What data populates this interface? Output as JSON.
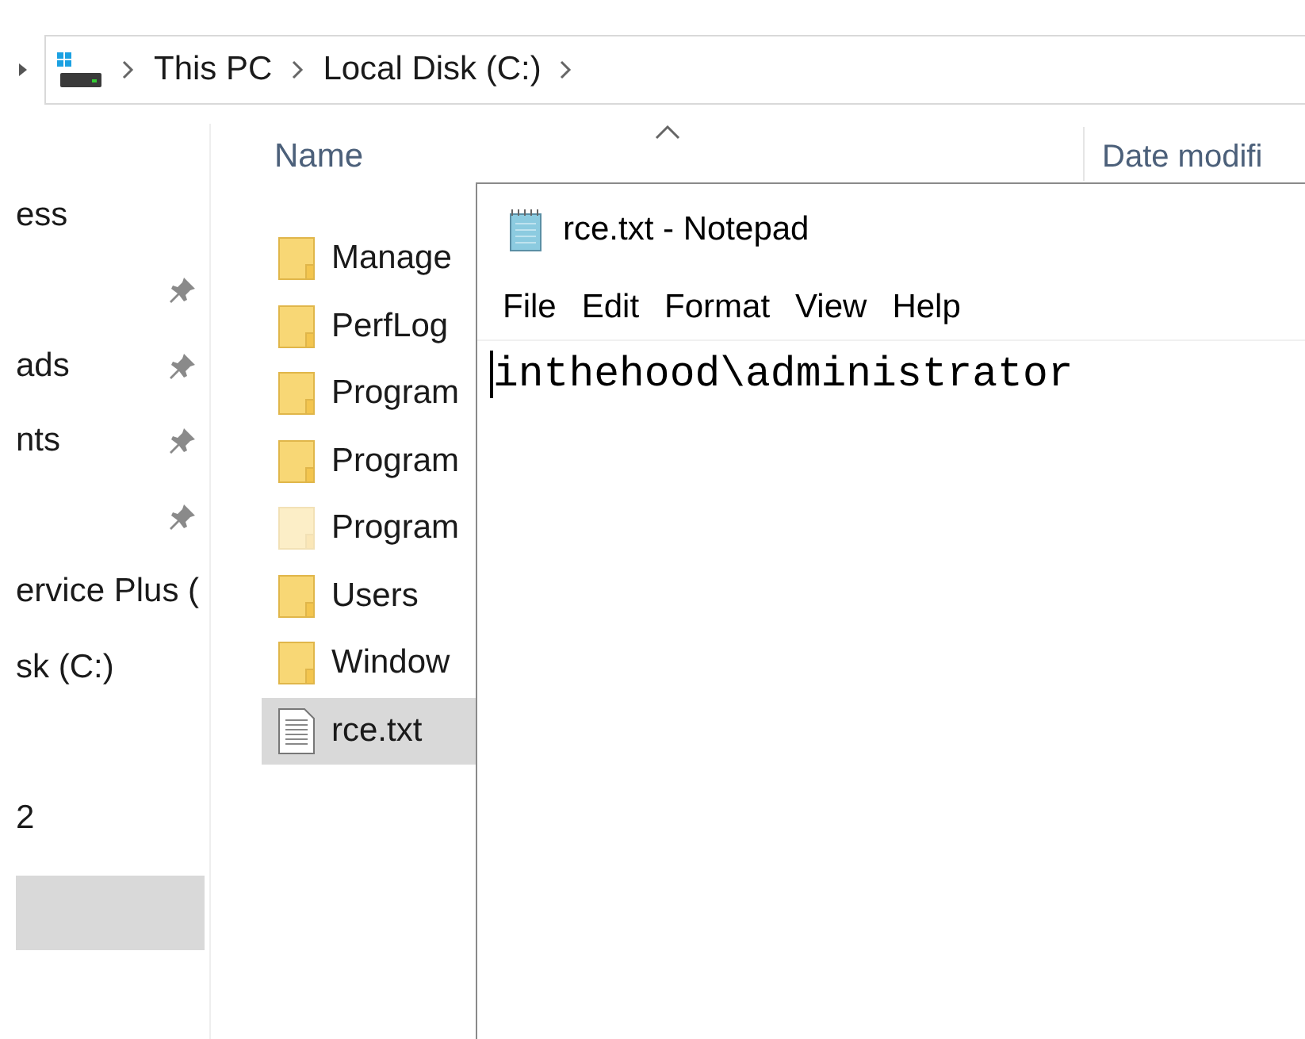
{
  "address_bar": {
    "crumbs": [
      "This PC",
      "Local Disk (C:)"
    ]
  },
  "sidebar": {
    "items": [
      {
        "label": "ess",
        "pinned": false,
        "selected": false
      },
      {
        "pinned": true,
        "selected": false
      },
      {
        "label": "ads",
        "pinned": true,
        "selected": false
      },
      {
        "label": "nts",
        "pinned": true,
        "selected": false
      },
      {
        "pinned": true,
        "selected": false
      },
      {
        "label": "ervice Plus (",
        "pinned": false,
        "selected": false
      },
      {
        "label": "sk (C:)",
        "pinned": false,
        "selected": false
      },
      {
        "label": "2",
        "pinned": false,
        "selected": false
      },
      {
        "pinned": false,
        "selected": true
      }
    ]
  },
  "file_list": {
    "columns": [
      "Name",
      "Date modifi"
    ],
    "rows": [
      {
        "name": "Manage",
        "kind": "folder",
        "hidden": false,
        "selected": false
      },
      {
        "name": "PerfLog",
        "kind": "folder",
        "hidden": false,
        "selected": false
      },
      {
        "name": "Program",
        "kind": "folder",
        "hidden": false,
        "selected": false
      },
      {
        "name": "Program",
        "kind": "folder",
        "hidden": false,
        "selected": false
      },
      {
        "name": "Program",
        "kind": "folder",
        "hidden": true,
        "selected": false
      },
      {
        "name": "Users",
        "kind": "folder",
        "hidden": false,
        "selected": false
      },
      {
        "name": "Window",
        "kind": "folder",
        "hidden": false,
        "selected": false
      },
      {
        "name": "rce.txt",
        "kind": "file",
        "hidden": false,
        "selected": true
      }
    ]
  },
  "notepad": {
    "title": "rce.txt - Notepad",
    "menu": [
      "File",
      "Edit",
      "Format",
      "View",
      "Help"
    ],
    "content": "inthehood\\administrator"
  }
}
